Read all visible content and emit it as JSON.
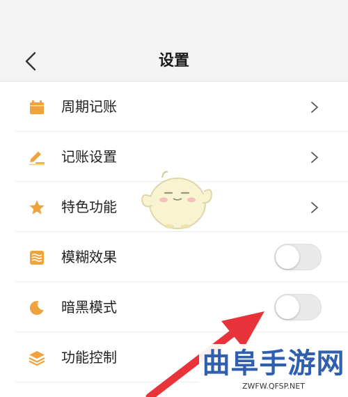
{
  "header": {
    "title": "设置",
    "back_icon": "chevron-left-icon"
  },
  "settings": {
    "items": [
      {
        "label": "周期记账",
        "icon": "calendar-icon",
        "control": "chevron"
      },
      {
        "label": "记账设置",
        "icon": "pen-icon",
        "control": "chevron"
      },
      {
        "label": "特色功能",
        "icon": "star-icon",
        "control": "chevron"
      },
      {
        "label": "模糊效果",
        "icon": "blur-icon",
        "control": "toggle",
        "on": false
      },
      {
        "label": "暗黑模式",
        "icon": "moon-icon",
        "control": "toggle",
        "on": false
      },
      {
        "label": "功能控制",
        "icon": "layers-icon",
        "control": "none"
      }
    ]
  },
  "colors": {
    "icon_accent": "#f0a23c",
    "annotation_arrow": "#e8333a",
    "watermark_text": "#2f5fae"
  },
  "watermark": {
    "title": "曲阜手游网",
    "url": "ZWFW.QFSP.NET"
  }
}
